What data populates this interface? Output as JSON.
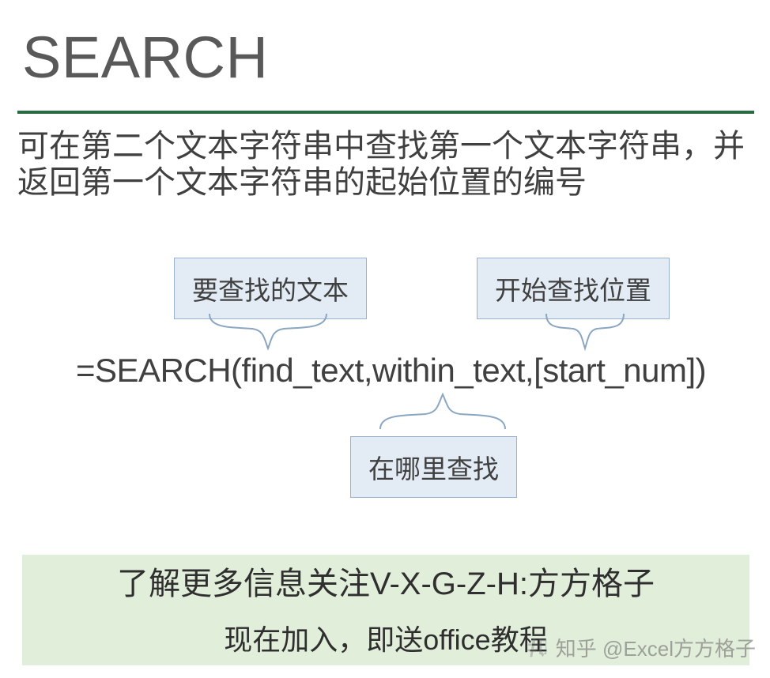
{
  "title": "SEARCH",
  "description": "可在第二个文本字符串中查找第一个文本字符串，并返回第一个文本字符串的起始位置的编号",
  "diagram": {
    "label_find_text": "要查找的文本",
    "label_start_num": "开始查找位置",
    "label_within_text": "在哪里查找",
    "formula": "=SEARCH(find_text,within_text,[start_num])"
  },
  "footer": {
    "line1": "了解更多信息关注V-X-G-Z-H:方方格子",
    "line2": "现在加入，即送office教程"
  },
  "watermark": "知乎 @Excel方方格子"
}
